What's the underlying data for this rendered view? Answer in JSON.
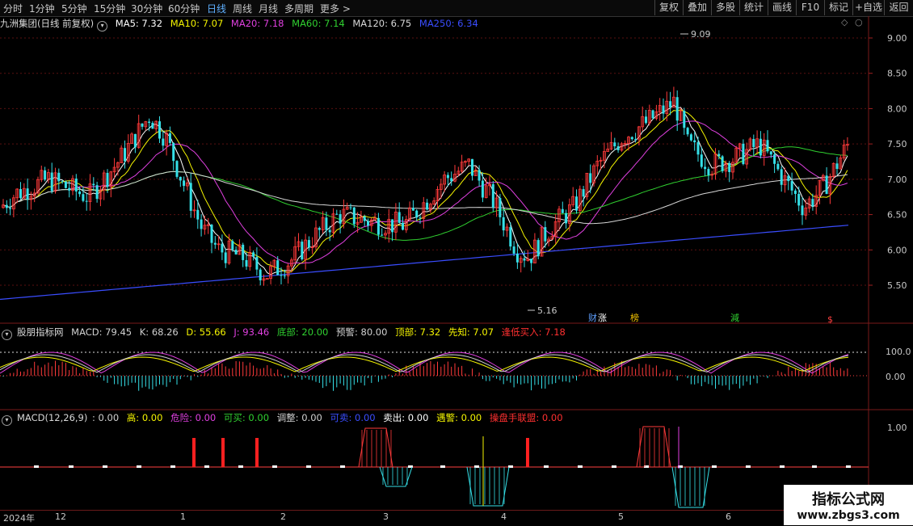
{
  "toolbar": {
    "periods": [
      "分时",
      "1分钟",
      "5分钟",
      "15分钟",
      "30分钟",
      "60分钟",
      "日线",
      "周线",
      "月线",
      "多周期",
      "更多 >"
    ],
    "active_period": "日线",
    "right_buttons": [
      "复权",
      "叠加",
      "多股",
      "统计",
      "画线",
      "F10",
      "标记",
      "+自选",
      "返回"
    ]
  },
  "main_legend": {
    "title": "九洲集团(日线 前复权)",
    "items": [
      {
        "label": "MA5: 7.32",
        "color": "#ffffff"
      },
      {
        "label": "MA10: 7.07",
        "color": "#f5f500"
      },
      {
        "label": "MA20: 7.18",
        "color": "#e040e0"
      },
      {
        "label": "MA60: 7.14",
        "color": "#30d030"
      },
      {
        "label": "MA120: 6.75",
        "color": "#d8d8d8"
      },
      {
        "label": "MA250: 6.34",
        "color": "#3a4dff"
      }
    ]
  },
  "price_axis": {
    "labels": [
      "9.00",
      "8.50",
      "8.00",
      "7.50",
      "7.00",
      "6.50",
      "6.00",
      "5.50"
    ]
  },
  "annotations": {
    "high": "9.09",
    "low": "5.16"
  },
  "event_tags": [
    {
      "text": "财",
      "color": "#5fa0ff"
    },
    {
      "text": "涨",
      "color": "#ffffff"
    },
    {
      "text": "榜",
      "color": "#f0c000"
    },
    {
      "text": "減",
      "color": "#30d030"
    },
    {
      "text": "$",
      "color": "#ff4040"
    }
  ],
  "ind1_legend": {
    "title": "股朋指标网",
    "items": [
      {
        "label": "MACD: 79.45",
        "color": "#d0d0d0"
      },
      {
        "label": "K: 68.26",
        "color": "#d0d0d0"
      },
      {
        "label": "D: 55.66",
        "color": "#f5f500"
      },
      {
        "label": "J: 93.46",
        "color": "#e040e0"
      },
      {
        "label": "底部: 20.00",
        "color": "#30d030"
      },
      {
        "label": "预警: 80.00",
        "color": "#d0d0d0"
      },
      {
        "label": "顶部: 7.32",
        "color": "#f5f500"
      },
      {
        "label": "先知: 7.07",
        "color": "#f5f500"
      },
      {
        "label": "逢低买入: 7.18",
        "color": "#ff3030"
      }
    ]
  },
  "ind1_axis": {
    "labels": [
      "100.0",
      "0.00"
    ]
  },
  "ind2_legend": {
    "title": "MACD(12,26,9)",
    "items": [
      {
        "label": ": 0.00",
        "color": "#d0d0d0"
      },
      {
        "label": "高: 0.00",
        "color": "#f5f500"
      },
      {
        "label": "危险: 0.00",
        "color": "#e040e0"
      },
      {
        "label": "可买: 0.00",
        "color": "#30d030"
      },
      {
        "label": "调整: 0.00",
        "color": "#d0d0d0"
      },
      {
        "label": "可卖: 0.00",
        "color": "#3a4dff"
      },
      {
        "label": "卖出: 0.00",
        "color": "#ffffff"
      },
      {
        "label": "遇警: 0.00",
        "color": "#f5f500"
      },
      {
        "label": "操盘手联盟: 0.00",
        "color": "#ff3030"
      }
    ]
  },
  "ind2_axis": {
    "labels": [
      "1.00"
    ]
  },
  "date_axis": {
    "labels": [
      "2024年",
      "12",
      "1",
      "2",
      "3",
      "4",
      "5",
      "6"
    ]
  },
  "watermark": {
    "line1": "指标公式网",
    "line2": "www.zbgs3.com"
  }
}
